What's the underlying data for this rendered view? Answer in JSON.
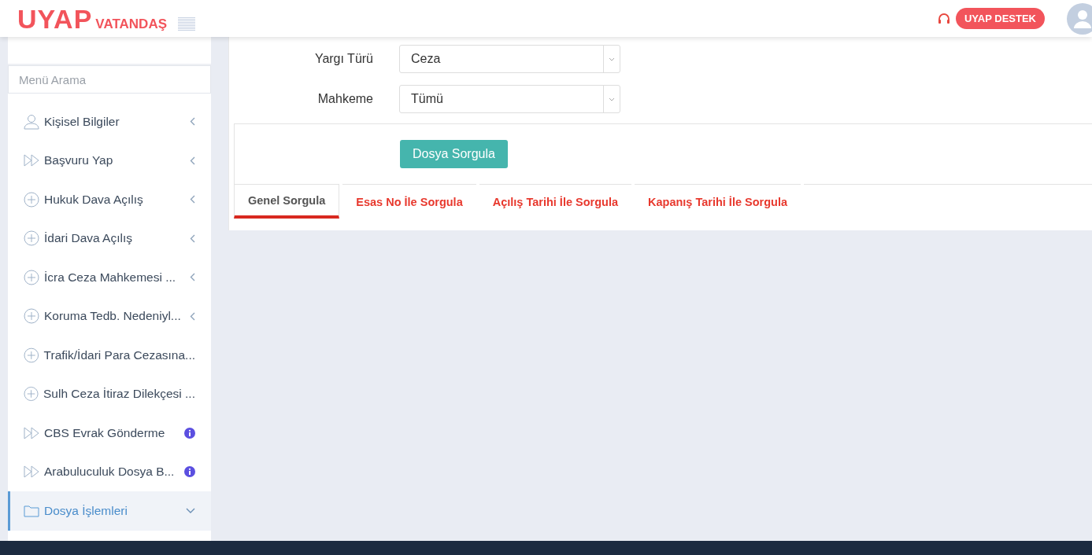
{
  "header": {
    "logo_main": "UYAP",
    "logo_sub": "VATANDAŞ",
    "support_button": "UYAP DESTEK"
  },
  "sidebar": {
    "search": {
      "placeholder": "Menü Arama"
    },
    "items": [
      {
        "label": "Kişisel Bilgiler",
        "kind": "person",
        "expandable": true,
        "expanded": false,
        "info": false,
        "selected": false
      },
      {
        "label": "Başvuru Yap",
        "kind": "arrow",
        "expandable": true,
        "expanded": false,
        "info": false,
        "selected": false
      },
      {
        "label": "Hukuk Dava Açılış",
        "kind": "plus",
        "expandable": true,
        "expanded": false,
        "info": false,
        "selected": false
      },
      {
        "label": "İdari Dava Açılış",
        "kind": "plus",
        "expandable": true,
        "expanded": false,
        "info": false,
        "selected": false
      },
      {
        "label": "İcra Ceza Mahkemesi ...",
        "kind": "plus",
        "expandable": true,
        "expanded": false,
        "info": false,
        "selected": false
      },
      {
        "label": "Koruma Tedb. Nedeniyl...",
        "kind": "plus",
        "expandable": true,
        "expanded": false,
        "info": false,
        "selected": false
      },
      {
        "label": "Trafik/İdari Para Cezasına...",
        "kind": "plus",
        "expandable": false,
        "info": false,
        "selected": false
      },
      {
        "label": "Sulh Ceza İtiraz Dilekçesi ...",
        "kind": "plus",
        "expandable": false,
        "info": false,
        "selected": false
      },
      {
        "label": "CBS Evrak Gönderme",
        "kind": "arrow",
        "expandable": false,
        "info": true,
        "selected": false
      },
      {
        "label": "Arabuluculuk Dosya B...",
        "kind": "arrow",
        "expandable": false,
        "info": true,
        "selected": false
      },
      {
        "label": "Dosya İşlemleri",
        "kind": "folder",
        "expandable": true,
        "expanded": true,
        "info": false,
        "selected": true
      }
    ]
  },
  "form": {
    "fields": [
      {
        "label": "Yargı Türü",
        "value": "Ceza"
      },
      {
        "label": "Mahkeme",
        "value": "Tümü"
      }
    ],
    "submit_button": "Dosya Sorgula"
  },
  "tabs": [
    {
      "label": "Genel Sorgula",
      "selected": true
    },
    {
      "label": "Esas No İle Sorgula",
      "selected": false
    },
    {
      "label": "Açılış Tarihi İle Sorgula",
      "selected": false
    },
    {
      "label": "Kapanış Tarihi İle Sorgula",
      "selected": false
    }
  ]
}
